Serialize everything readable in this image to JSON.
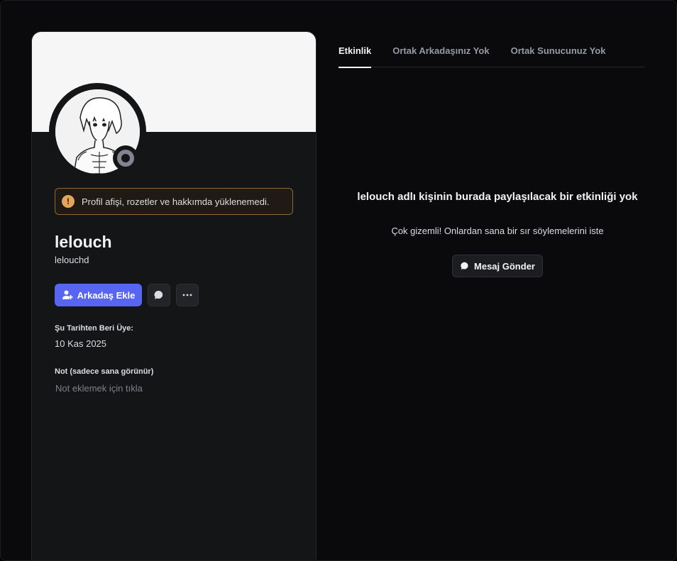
{
  "profile": {
    "display_name": "lelouch",
    "username": "lelouchd",
    "status": "offline",
    "warning_text": "Profil afişi, rozetler ve hakkımda yüklenemedi.",
    "add_friend_label": "Arkadaş Ekle",
    "member_since_title": "Şu Tarihten Beri Üye:",
    "member_since_value": "10 Kas 2025",
    "note_title": "Not (sadece sana görünür)",
    "note_placeholder": "Not eklemek için tıkla"
  },
  "tabs": [
    {
      "label": "Etkinlik",
      "active": true
    },
    {
      "label": "Ortak Arkadaşınız Yok",
      "active": false
    },
    {
      "label": "Ortak Sunucunuz Yok",
      "active": false
    }
  ],
  "activity": {
    "empty_title": "lelouch adlı kişinin burada paylaşılacak bir etkinliği yok",
    "empty_subtitle": "Çok gizemli! Onlardan sana bir sır söylemelerini iste",
    "message_button_label": "Mesaj Gönder"
  },
  "colors": {
    "accent": "#5865f2",
    "warning": "#e4a55b",
    "status_offline": "#82858f"
  },
  "icons": {
    "warning": "exclamation-circle-icon",
    "add_friend": "add-user-icon",
    "message": "chat-bubble-icon",
    "more": "ellipsis-icon"
  }
}
